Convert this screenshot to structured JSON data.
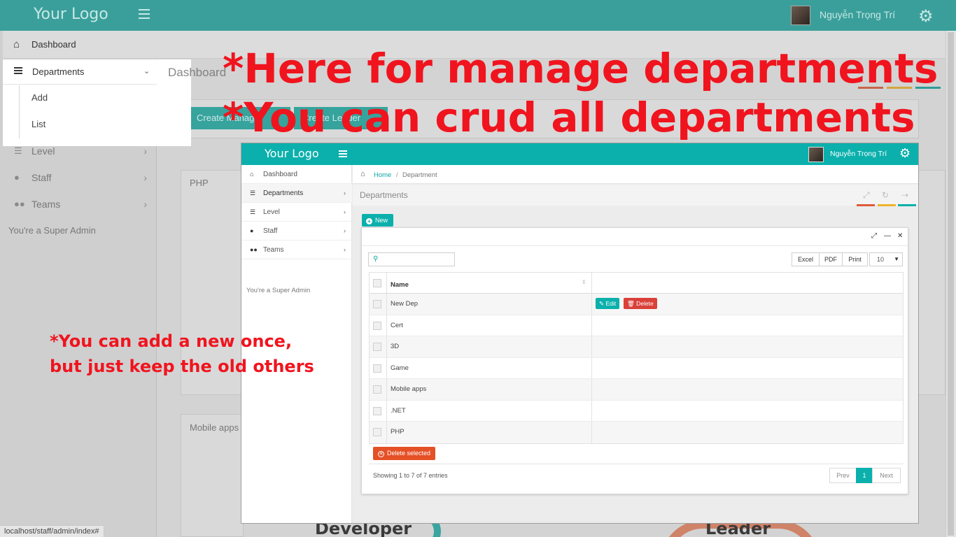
{
  "background": {
    "logo": "Your Logo",
    "user_name": "Nguyễn Trọng Trí",
    "sidebar": {
      "items": [
        {
          "label": "Dashboard",
          "icon": "home-icon"
        },
        {
          "label": "Departments",
          "icon": "list-icon"
        },
        {
          "label": "Level",
          "icon": "list-icon"
        },
        {
          "label": "Staff",
          "icon": "user-icon"
        },
        {
          "label": "Teams",
          "icon": "users-icon"
        }
      ],
      "submenu": [
        "Add",
        "List"
      ],
      "role_note": "You're a Super Admin"
    },
    "page_title": "Dashboard",
    "buttons": [
      "Create Manager",
      "Create Leader"
    ],
    "cards": [
      "PHP",
      "Mobile apps"
    ],
    "bottom_labels": [
      "Developer",
      "Leader"
    ],
    "status_url": "localhost/staff/admin/index#",
    "accent_colors": [
      "#e05a3a",
      "#f0b429",
      "#0bb0ac"
    ]
  },
  "annotations": {
    "line1": "*Here for manage departments",
    "line2": "*You can crud all departments",
    "line3a": "*You can add a new once,",
    "line3b": "but just keep the old others",
    "color": "#f0141e"
  },
  "inset": {
    "logo": "Your Logo",
    "user_name": "Nguyễn Trọng Trí",
    "sidebar": {
      "items": [
        {
          "label": "Dashboard"
        },
        {
          "label": "Departments"
        },
        {
          "label": "Level"
        },
        {
          "label": "Staff"
        },
        {
          "label": "Teams"
        }
      ],
      "role_note": "You're a Super Admin"
    },
    "breadcrumb": {
      "home": "Home",
      "separator": "/",
      "current": "Department"
    },
    "section_title": "Departments",
    "new_button": "New",
    "search": {
      "placeholder": "",
      "value": ""
    },
    "export_buttons": [
      "Excel",
      "PDF",
      "Print"
    ],
    "page_size": "10",
    "table": {
      "columns": [
        "Name",
        ""
      ],
      "rows": [
        "New Dep",
        "Cert",
        "3D",
        "Game",
        "Mobile apps",
        ".NET",
        "PHP"
      ],
      "row_actions": {
        "edit": "Edit",
        "delete": "Delete"
      }
    },
    "delete_selected": "Delete selected",
    "showing": "Showing 1 to 7 of 7 entries",
    "pagination": {
      "prev": "Prev",
      "current": "1",
      "next": "Next"
    },
    "brand_color": "#0bb0ac",
    "danger_color": "#d9413a"
  }
}
